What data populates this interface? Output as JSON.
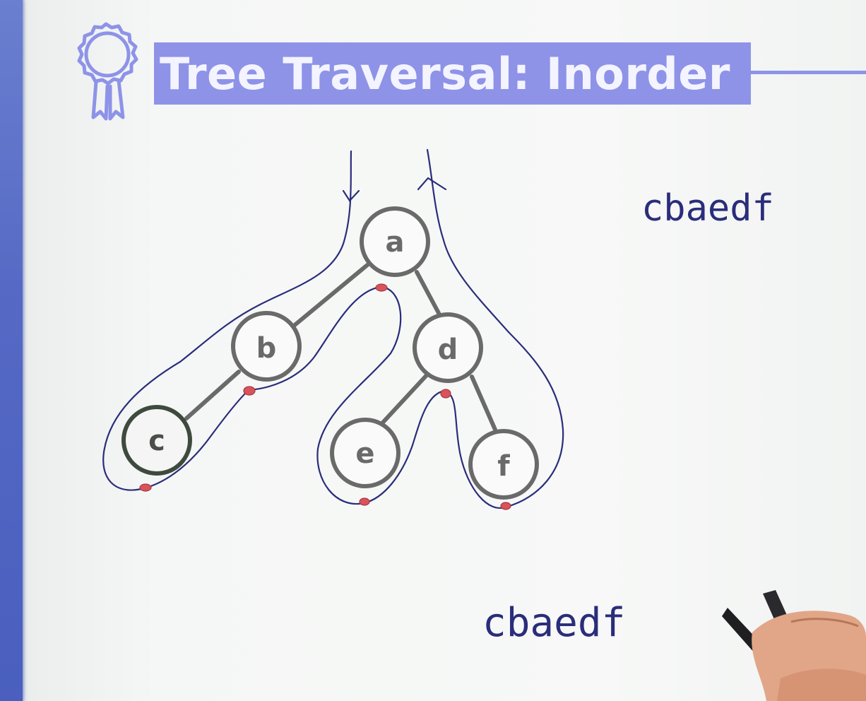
{
  "slide": {
    "title": "Tree Traversal: Inorder"
  },
  "tree": {
    "nodes": [
      "a",
      "b",
      "d",
      "c",
      "e",
      "f"
    ],
    "edges": [
      [
        "a",
        "b"
      ],
      [
        "a",
        "d"
      ],
      [
        "b",
        "c"
      ],
      [
        "d",
        "e"
      ],
      [
        "d",
        "f"
      ]
    ]
  },
  "annotations": {
    "result_top": "cbaedf",
    "result_bottom": "cbaedf"
  },
  "colors": {
    "title_bg": "#8e93e8",
    "left_bar": "#5468c4",
    "node_stroke": "#6a6a6a",
    "node_c_stroke": "#3e4a3e",
    "ink": "#2a2d7a",
    "visit_dot": "#d9535a"
  }
}
